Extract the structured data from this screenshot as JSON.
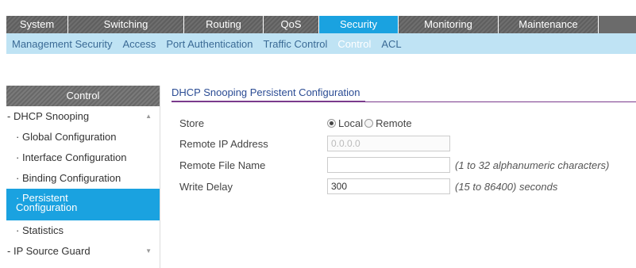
{
  "main_nav": {
    "tabs": [
      {
        "label": "System",
        "active": false
      },
      {
        "label": "Switching",
        "active": false
      },
      {
        "label": "Routing",
        "active": false
      },
      {
        "label": "QoS",
        "active": false
      },
      {
        "label": "Security",
        "active": true
      },
      {
        "label": "Monitoring",
        "active": false
      },
      {
        "label": "Maintenance",
        "active": false
      }
    ]
  },
  "sub_nav": {
    "items": [
      {
        "label": "Management Security",
        "active": false
      },
      {
        "label": "Access",
        "active": false
      },
      {
        "label": "Port Authentication",
        "active": false
      },
      {
        "label": "Traffic Control",
        "active": false
      },
      {
        "label": "Control",
        "active": true
      },
      {
        "label": "ACL",
        "active": false
      }
    ]
  },
  "sidebar": {
    "header": "Control",
    "items": [
      {
        "label": "DHCP Snooping",
        "type": "group",
        "icon": "chevron-up-icon"
      },
      {
        "label": "Global Configuration",
        "type": "child"
      },
      {
        "label": "Interface Configuration",
        "type": "child"
      },
      {
        "label": "Binding Configuration",
        "type": "child"
      },
      {
        "label": "Persistent Configuration",
        "line1": "Persistent",
        "line2": "Configuration",
        "type": "child",
        "active": true
      },
      {
        "label": "Statistics",
        "type": "child"
      },
      {
        "label": "IP Source Guard",
        "type": "group",
        "icon": "chevron-down-icon"
      }
    ]
  },
  "main": {
    "title": "DHCP Snooping Persistent Configuration",
    "store": {
      "label": "Store",
      "options": [
        {
          "label": "Local",
          "selected": true
        },
        {
          "label": "Remote",
          "selected": false
        }
      ]
    },
    "remote_ip": {
      "label": "Remote IP Address",
      "value": "0.0.0.0"
    },
    "remote_file": {
      "label": "Remote File Name",
      "value": "",
      "hint": "(1 to 32 alphanumeric characters)"
    },
    "write_delay": {
      "label": "Write Delay",
      "value": "300",
      "hint": "(15 to 86400) seconds"
    }
  },
  "colors": {
    "accent": "#1aa2e0",
    "tab_gray": "#666666",
    "subnav_bg": "#bfe3f4",
    "title_blue": "#2b4c94",
    "title_underline": "#7a3a8c"
  }
}
